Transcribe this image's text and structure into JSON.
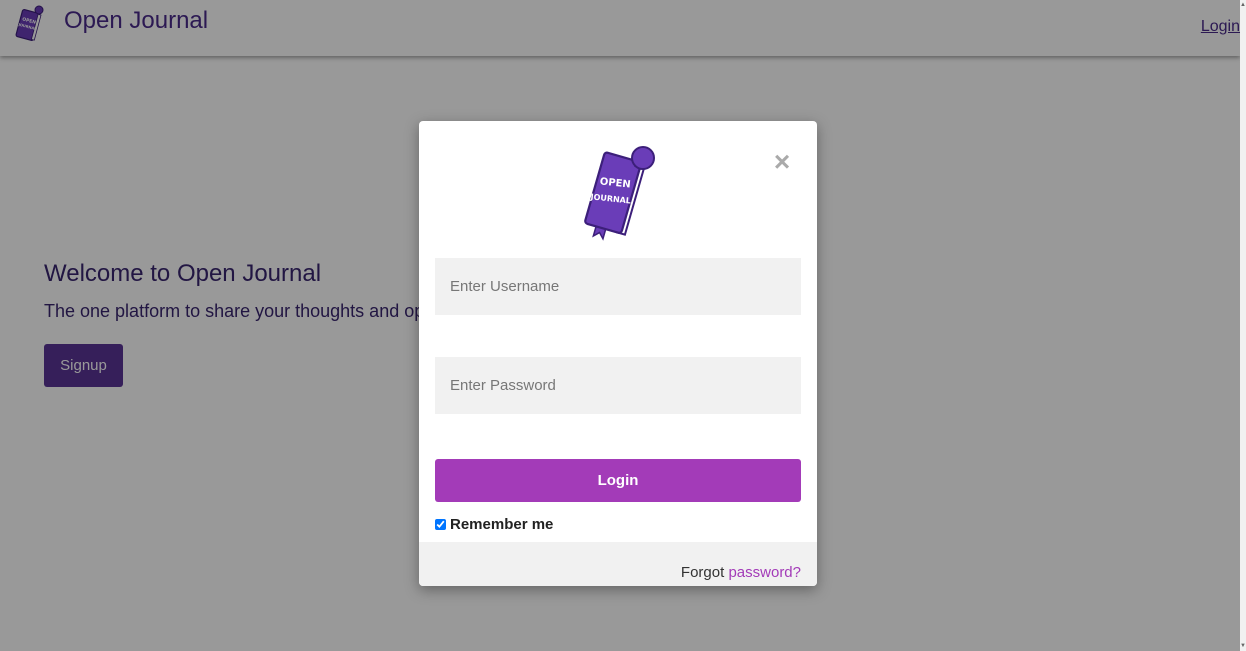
{
  "navbar": {
    "brand": "Open Journal",
    "login_link": "Login"
  },
  "hero": {
    "title": "Welcome to Open Journal",
    "subtitle": "The one platform to share your thoughts and op",
    "signup_label": "Signup"
  },
  "modal": {
    "logo_text": [
      "OPEN",
      "JOURNAL"
    ],
    "close_icon": "close-icon",
    "username_placeholder": "Enter Username",
    "password_placeholder": "Enter Password",
    "login_label": "Login",
    "remember_label": "Remember me",
    "remember_checked": true,
    "forgot_prefix": "Forgot",
    "forgot_link": "password?"
  },
  "colors": {
    "brand": "#4a2a8a",
    "accent": "#a33bb8",
    "logo": "#6a3db8"
  }
}
